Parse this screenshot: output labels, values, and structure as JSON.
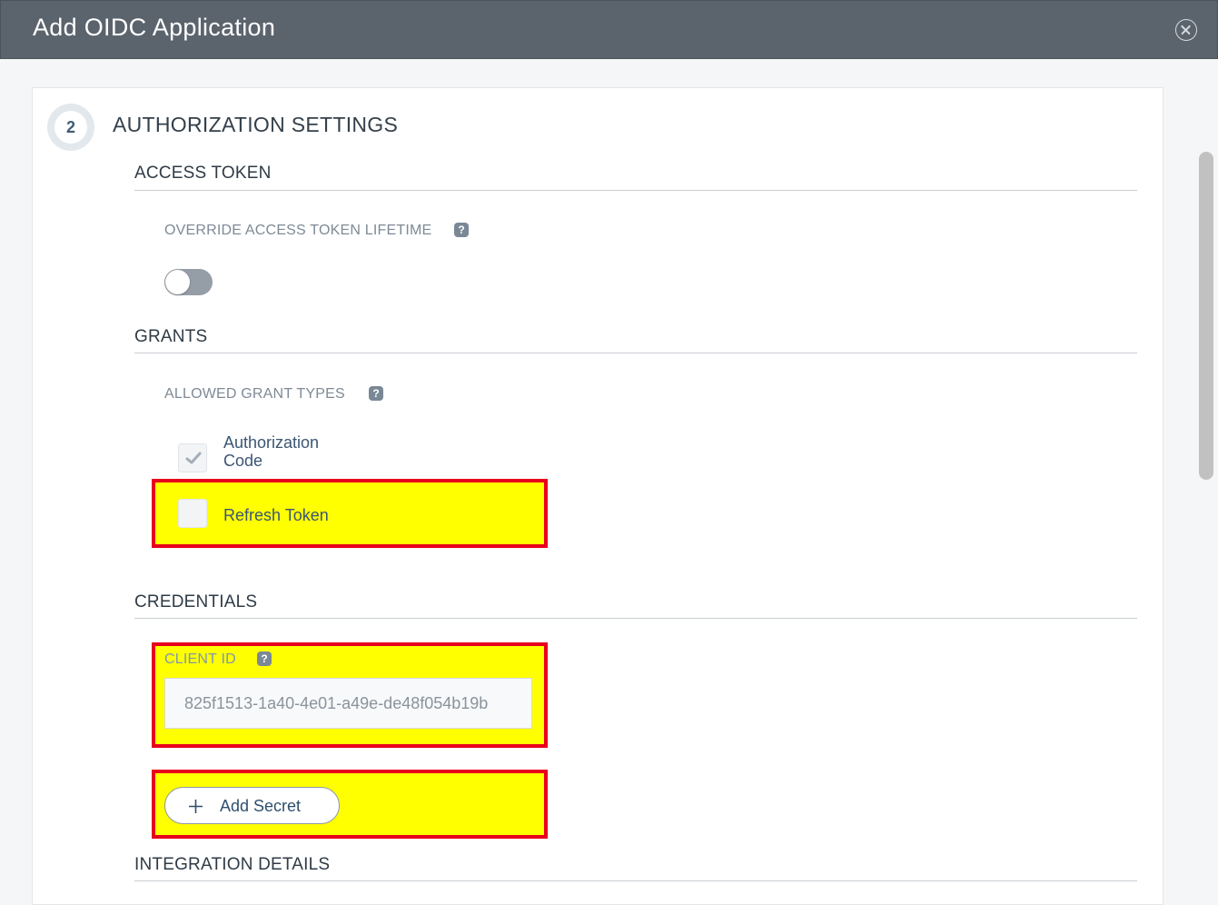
{
  "dialog": {
    "title": "Add OIDC Application"
  },
  "step": {
    "number": "2",
    "title": "AUTHORIZATION SETTINGS"
  },
  "access_token": {
    "heading": "ACCESS TOKEN",
    "override_label": "OVERRIDE ACCESS TOKEN LIFETIME",
    "override_enabled": false
  },
  "grants": {
    "heading": "GRANTS",
    "allowed_label": "ALLOWED GRANT TYPES",
    "types": [
      {
        "label_line1": "Authorization",
        "label_line2": "Code",
        "checked": true,
        "disabled": true
      },
      {
        "label": "Refresh Token",
        "checked": false
      }
    ]
  },
  "credentials": {
    "heading": "CREDENTIALS",
    "client_id_label": "CLIENT ID",
    "client_id_value": "825f1513-1a40-4e01-a49e-de48f054b19b",
    "add_secret_label": "Add Secret"
  },
  "integration": {
    "heading": "INTEGRATION DETAILS"
  },
  "help_icon_glyph": "?",
  "colors": {
    "header_bg": "#5b646d",
    "highlight_fill": "#ffff00",
    "highlight_border": "#e8001c"
  }
}
